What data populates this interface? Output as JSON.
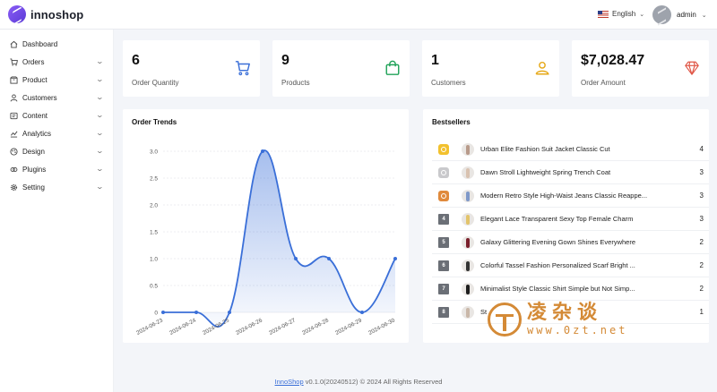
{
  "header": {
    "app_name": "innoshop",
    "language": "English",
    "user": "admin"
  },
  "sidebar": {
    "items": [
      {
        "label": "Dashboard",
        "icon": "home-icon",
        "expandable": false
      },
      {
        "label": "Orders",
        "icon": "cart-icon",
        "expandable": true
      },
      {
        "label": "Product",
        "icon": "box-icon",
        "expandable": true
      },
      {
        "label": "Customers",
        "icon": "user-icon",
        "expandable": true
      },
      {
        "label": "Content",
        "icon": "document-icon",
        "expandable": true
      },
      {
        "label": "Analytics",
        "icon": "chart-icon",
        "expandable": true
      },
      {
        "label": "Design",
        "icon": "palette-icon",
        "expandable": true
      },
      {
        "label": "Plugins",
        "icon": "plugin-icon",
        "expandable": true
      },
      {
        "label": "Setting",
        "icon": "gear-icon",
        "expandable": true
      }
    ]
  },
  "stats": [
    {
      "value": "6",
      "label": "Order Quantity",
      "icon": "cart-icon",
      "color": "#3a6fd8"
    },
    {
      "value": "9",
      "label": "Products",
      "icon": "bag-icon",
      "color": "#22a35a"
    },
    {
      "value": "1",
      "label": "Customers",
      "icon": "user-icon",
      "color": "#e6a817"
    },
    {
      "value": "$7,028.47",
      "label": "Order Amount",
      "icon": "diamond-icon",
      "color": "#e05545"
    }
  ],
  "order_trends": {
    "title": "Order Trends"
  },
  "chart_data": {
    "type": "area",
    "title": "Order Trends",
    "x": [
      "2024-06-23",
      "2024-06-24",
      "2024-06-25",
      "2024-06-26",
      "2024-06-27",
      "2024-06-28",
      "2024-06-29",
      "2024-06-30"
    ],
    "series": [
      {
        "values": [
          0,
          0,
          0,
          3,
          1,
          1,
          0,
          1
        ]
      }
    ],
    "ylim": [
      0,
      3
    ],
    "yticks": [
      "0",
      "0.5",
      "1.0",
      "1.5",
      "2.0",
      "2.5",
      "3.0"
    ],
    "grid": true,
    "color": "#3a6fd8"
  },
  "bestsellers": {
    "title": "Bestsellers",
    "rows": [
      {
        "rank": "1",
        "name": "Urban Elite Fashion Suit Jacket Classic Cut",
        "qty": "4",
        "medal": "gold"
      },
      {
        "rank": "2",
        "name": "Dawn Stroll Lightweight Spring Trench Coat",
        "qty": "3",
        "medal": "silver"
      },
      {
        "rank": "3",
        "name": "Modern Retro Style High-Waist Jeans Classic Reappe...",
        "qty": "3",
        "medal": "bronze"
      },
      {
        "rank": "4",
        "name": "Elegant Lace Transparent Sexy Top Female Charm",
        "qty": "3",
        "medal": ""
      },
      {
        "rank": "5",
        "name": "Galaxy Glittering Evening Gown Shines Everywhere",
        "qty": "2",
        "medal": ""
      },
      {
        "rank": "6",
        "name": "Colorful Tassel Fashion Personalized Scarf Bright ...",
        "qty": "2",
        "medal": ""
      },
      {
        "rank": "7",
        "name": "Minimalist Style Classic Shirt Simple but Not Simp...",
        "qty": "2",
        "medal": ""
      },
      {
        "rank": "8",
        "name": "St",
        "qty": "1",
        "medal": ""
      }
    ]
  },
  "footer": {
    "link": "InnoShop",
    "text": " v0.1.0(20240512) © 2024 All Rights Reserved"
  },
  "watermark": {
    "cn": "凌杂谈",
    "url": "www.0zt.net"
  }
}
